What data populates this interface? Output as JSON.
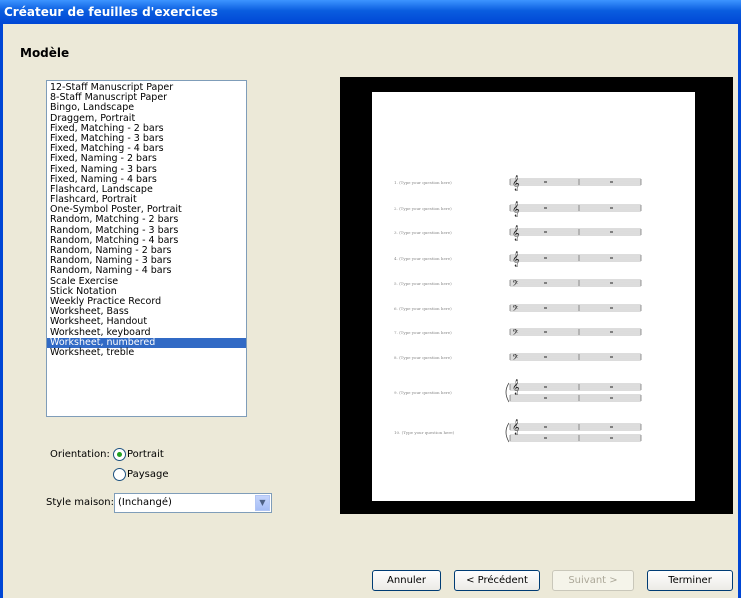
{
  "window": {
    "title": "Créateur de feuilles d'exercices"
  },
  "section": {
    "title": "Modèle"
  },
  "templates": [
    "12-Staff Manuscript Paper",
    "8-Staff Manuscript Paper",
    "Bingo, Landscape",
    "Draggem, Portrait",
    "Fixed, Matching - 2 bars",
    "Fixed, Matching - 3 bars",
    "Fixed, Matching - 4 bars",
    "Fixed, Naming - 2 bars",
    "Fixed, Naming - 3 bars",
    "Fixed, Naming - 4 bars",
    "Flashcard, Landscape",
    "Flashcard, Portrait",
    "One-Symbol Poster, Portrait",
    "Random, Matching - 2 bars",
    "Random, Matching - 3 bars",
    "Random, Matching - 4 bars",
    "Random, Naming - 2 bars",
    "Random, Naming - 3 bars",
    "Random, Naming - 4 bars",
    "Scale Exercise",
    "Stick Notation",
    "Weekly Practice Record",
    "Worksheet, Bass",
    "Worksheet, Handout",
    "Worksheet, keyboard",
    "Worksheet, numbered",
    "Worksheet, treble"
  ],
  "selected_template": "Worksheet, numbered",
  "orientation": {
    "label": "Orientation:",
    "portrait": "Portrait",
    "landscape": "Paysage",
    "selected": "Portrait"
  },
  "house_style": {
    "label": "Style maison:",
    "value": "(Inchangé)"
  },
  "preview": {
    "questions": [
      {
        "text": "1. (Type your question here)",
        "clef": "treble-clef-icon"
      },
      {
        "text": "2. (Type your question here)",
        "clef": "treble-clef-icon"
      },
      {
        "text": "3. (Type your question here)",
        "clef": "treble-clef-icon"
      },
      {
        "text": "4. (Type your question here)",
        "clef": "treble-clef-icon"
      },
      {
        "text": "5. (Type your question here)",
        "clef": "bass-clef-icon"
      },
      {
        "text": "6. (Type your question here)",
        "clef": "bass-clef-icon"
      },
      {
        "text": "7. (Type your question here)",
        "clef": "bass-clef-icon"
      },
      {
        "text": "8. (Type your question here)",
        "clef": "bass-clef-icon"
      },
      {
        "text": "9. (Type your question here)",
        "clef": "grand-staff-icon"
      },
      {
        "text": "10. (Type your question here)",
        "clef": "grand-staff-icon"
      }
    ]
  },
  "buttons": {
    "cancel": "Annuler",
    "previous": "< Précédent",
    "next": "Suivant >",
    "finish": "Terminer"
  }
}
